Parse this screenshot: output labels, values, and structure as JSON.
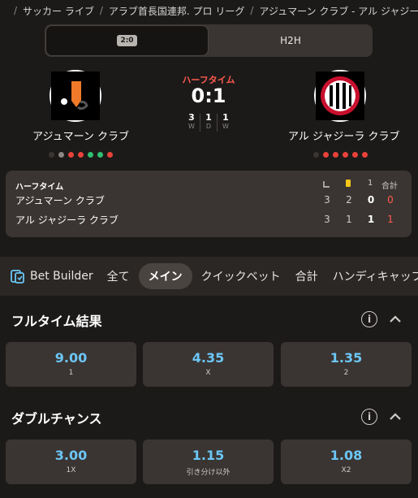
{
  "breadcrumb": {
    "items": [
      "サッカー ライブ",
      "アラブ首長国連邦. プロ リーグ",
      "アジュマーン クラブ - アル ジャジーラ クラブ"
    ]
  },
  "toggle": {
    "score_chip": "2:0",
    "h2h_label": "H2H"
  },
  "match": {
    "status": "ハーフタイム",
    "score": "0:1",
    "home": {
      "name": "アジュマーン クラブ",
      "form": [
        "#3a3532",
        "#8a8784",
        "#e8423a",
        "#e8423a",
        "#2fbf71",
        "#2fbf71",
        "#e8423a"
      ]
    },
    "away": {
      "name": "アル ジャジーラ クラブ",
      "form": [
        "#3a3532",
        "#e8423a",
        "#e8423a",
        "#e8423a",
        "#e8423a",
        "#e8423a"
      ]
    },
    "wdl": [
      {
        "num": "3",
        "lbl": "W"
      },
      {
        "num": "1",
        "lbl": "D"
      },
      {
        "num": "1",
        "lbl": "W"
      }
    ]
  },
  "stats": {
    "title": "ハーフタイム",
    "col_total": "合計",
    "col_goal_marker": "1",
    "rows": [
      {
        "team": "アジュマーン クラブ",
        "corners": "3",
        "yellow": "2",
        "goals": "0",
        "total": "0"
      },
      {
        "team": "アル ジャジーラ クラブ",
        "corners": "3",
        "yellow": "1",
        "goals": "1",
        "total": "1"
      }
    ]
  },
  "tabs": [
    "Bet Builder",
    "全て",
    "メイン",
    "クイックベット",
    "合計",
    "ハンディキャップ"
  ],
  "markets": [
    {
      "title": "フルタイム結果",
      "odds": [
        {
          "price": "9.00",
          "label": "1"
        },
        {
          "price": "4.35",
          "label": "X"
        },
        {
          "price": "1.35",
          "label": "2"
        }
      ]
    },
    {
      "title": "ダブルチャンス",
      "odds": [
        {
          "price": "3.00",
          "label": "1X"
        },
        {
          "price": "1.15",
          "label": "引き分け以外"
        },
        {
          "price": "1.08",
          "label": "X2"
        }
      ]
    }
  ],
  "colors": {
    "accent_red": "#ff5a4d",
    "odds_blue": "#6cc6f7",
    "panel": "#3a3532"
  }
}
